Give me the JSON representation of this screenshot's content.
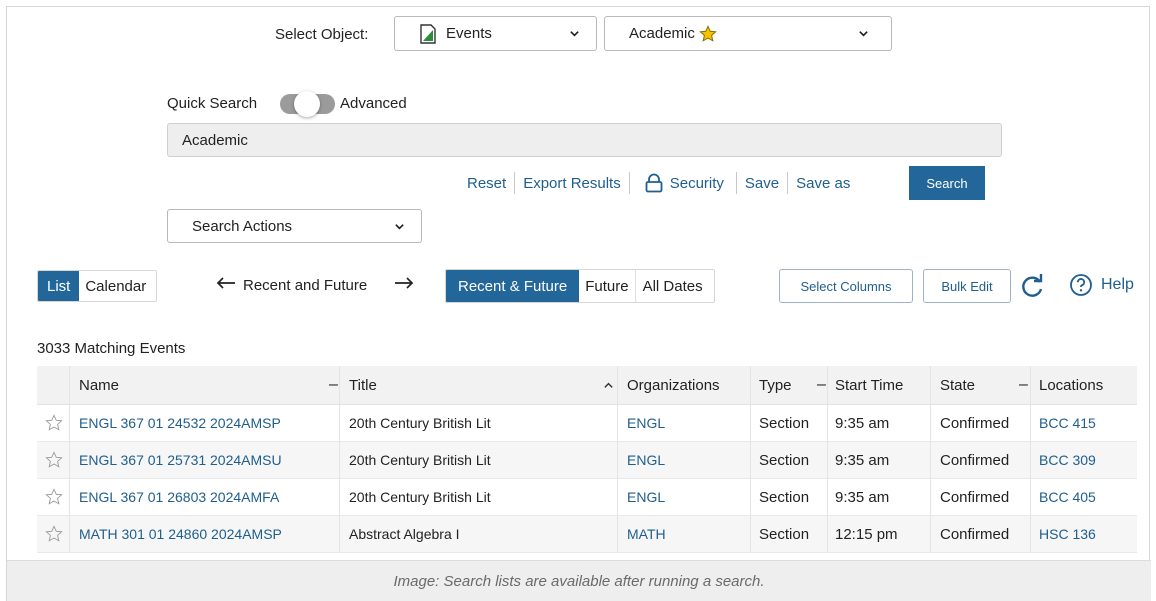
{
  "select_object": {
    "label": "Select Object:",
    "object_value": "Events",
    "search_value": "Academic"
  },
  "search_mode": {
    "quick_label": "Quick Search",
    "advanced_label": "Advanced"
  },
  "search_input": {
    "value": "Academic"
  },
  "actions": {
    "reset": "Reset",
    "export": "Export Results",
    "security": "Security",
    "save": "Save",
    "save_as": "Save as",
    "search": "Search"
  },
  "search_actions": {
    "label": "Search Actions"
  },
  "view_toggle": {
    "list": "List",
    "calendar": "Calendar"
  },
  "date_nav": {
    "label": "Recent and Future"
  },
  "date_filter": {
    "recent_future": "Recent & Future",
    "future": "Future",
    "all_dates": "All Dates"
  },
  "tools": {
    "select_columns": "Select Columns",
    "bulk_edit": "Bulk Edit",
    "help": "Help"
  },
  "results": {
    "count_text": "3033 Matching Events"
  },
  "table": {
    "columns": [
      "Name",
      "Title",
      "Organizations",
      "Type",
      "Start Time",
      "State",
      "Locations"
    ],
    "rows": [
      {
        "name": "ENGL 367 01 24532 2024AMSP",
        "title": "20th Century British Lit",
        "org": "ENGL",
        "type": "Section",
        "start": "9:35 am",
        "state": "Confirmed",
        "location": "BCC 415"
      },
      {
        "name": "ENGL 367 01 25731 2024AMSU",
        "title": "20th Century British Lit",
        "org": "ENGL",
        "type": "Section",
        "start": "9:35 am",
        "state": "Confirmed",
        "location": "BCC 309"
      },
      {
        "name": "ENGL 367 01 26803 2024AMFA",
        "title": "20th Century British Lit",
        "org": "ENGL",
        "type": "Section",
        "start": "9:35 am",
        "state": "Confirmed",
        "location": "BCC 405"
      },
      {
        "name": "MATH 301 01 24860 2024AMSP",
        "title": "Abstract Algebra I",
        "org": "MATH",
        "type": "Section",
        "start": "12:15 pm",
        "state": "Confirmed",
        "location": "HSC 136"
      }
    ]
  },
  "caption": {
    "text": "Image: Search lists are available after running a search."
  },
  "colors": {
    "accent": "#23679a",
    "link": "#1f5e8e",
    "star": "#f2c200"
  }
}
